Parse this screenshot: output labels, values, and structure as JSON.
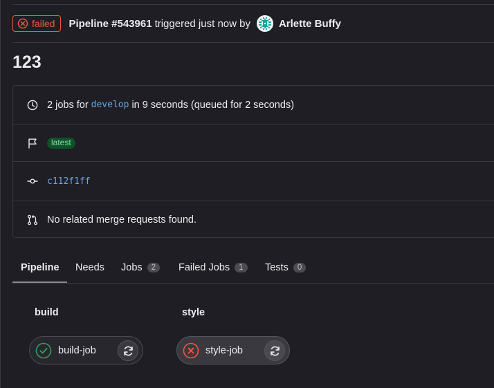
{
  "header": {
    "status": "failed",
    "pipeline_label": "Pipeline #543961",
    "triggered_text": "triggered just now by",
    "user_name": "Arlette Buffy"
  },
  "page_title": "123",
  "info": {
    "jobs_count_text": "2 jobs for",
    "branch": "develop",
    "duration_text": "in 9 seconds (queued for 2 seconds)",
    "tag": "latest",
    "commit_sha": "c112f1ff",
    "merge_requests_text": "No related merge requests found."
  },
  "tabs": [
    {
      "label": "Pipeline"
    },
    {
      "label": "Needs"
    },
    {
      "label": "Jobs",
      "count": "2"
    },
    {
      "label": "Failed Jobs",
      "count": "1"
    },
    {
      "label": "Tests",
      "count": "0"
    }
  ],
  "stages": [
    {
      "name": "build",
      "job": "build-job",
      "status": "success"
    },
    {
      "name": "style",
      "job": "style-job",
      "status": "failed"
    }
  ],
  "colors": {
    "background": "#1f1e24",
    "failed": "#ec5941",
    "success": "#2da160",
    "link": "#63a6e9",
    "border": "#3a383f"
  },
  "icons": {
    "status": "failed-circle-icon",
    "clock": "clock-icon",
    "flag": "flag-icon",
    "commit": "commit-icon",
    "merge_request": "merge-request-icon",
    "job_success": "check-circle-icon",
    "job_failed": "x-circle-icon",
    "retry": "retry-icon"
  }
}
